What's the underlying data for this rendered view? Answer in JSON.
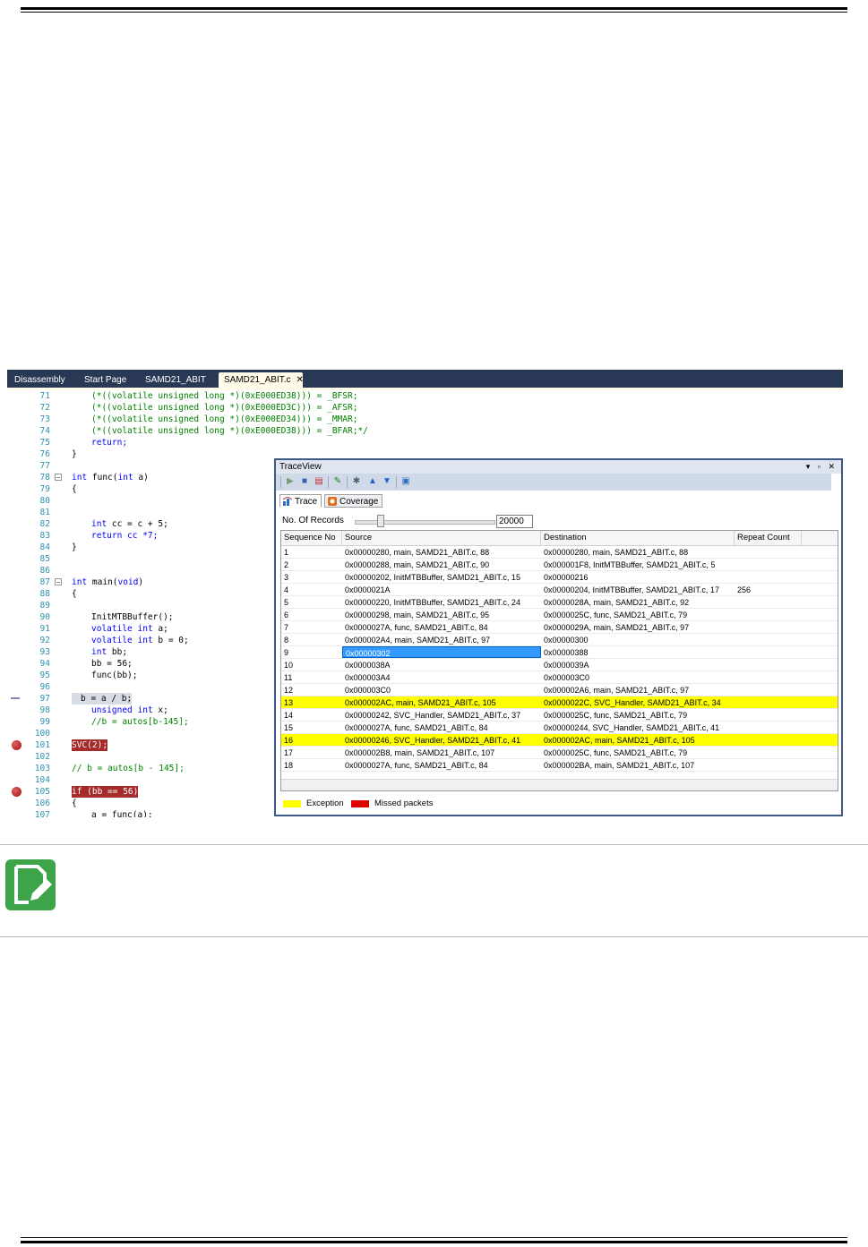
{
  "editor": {
    "tabs": [
      {
        "label": "Disassembly"
      },
      {
        "label": "Start Page"
      },
      {
        "label": "SAMD21_ABIT"
      },
      {
        "label": "SAMD21_ABIT.c"
      }
    ],
    "close_glyph": "✕",
    "lines": [
      {
        "n": "71",
        "text": "(*((volatile unsigned long *)(0xE000ED38))) = _BFSR;",
        "style": "cm"
      },
      {
        "n": "72",
        "text": "(*((volatile unsigned long *)(0xE000ED3C))) = _AFSR;",
        "style": "cm"
      },
      {
        "n": "73",
        "text": "(*((volatile unsigned long *)(0xE000ED34))) = _MMAR;",
        "style": "cm"
      },
      {
        "n": "74",
        "text": "(*((volatile unsigned long *)(0xE000ED38))) = _BFAR;*/",
        "style": "cm"
      },
      {
        "n": "75",
        "text": "return;",
        "style": "kw"
      },
      {
        "n": "76",
        "text": "}",
        "style": ""
      },
      {
        "n": "77",
        "text": "",
        "style": ""
      },
      {
        "n": "78",
        "text": "int func(int a)",
        "style": "fn"
      },
      {
        "n": "79",
        "text": "{",
        "style": ""
      },
      {
        "n": "80",
        "text": "",
        "style": ""
      },
      {
        "n": "81",
        "text": "",
        "style": ""
      },
      {
        "n": "82",
        "text": "int cc = c + 5;",
        "style": "decl"
      },
      {
        "n": "83",
        "text": "return cc *7;",
        "style": "ret"
      },
      {
        "n": "84",
        "text": "}",
        "style": ""
      },
      {
        "n": "85",
        "text": "",
        "style": ""
      },
      {
        "n": "86",
        "text": "",
        "style": ""
      },
      {
        "n": "87",
        "text": "int main(void)",
        "style": "fn"
      },
      {
        "n": "88",
        "text": "{",
        "style": ""
      },
      {
        "n": "89",
        "text": "",
        "style": ""
      },
      {
        "n": "90",
        "text": "InitMTBBuffer();",
        "style": ""
      },
      {
        "n": "91",
        "text": "volatile int a;",
        "style": "vol"
      },
      {
        "n": "92",
        "text": "volatile int b = 0;",
        "style": "vol"
      },
      {
        "n": "93",
        "text": "int bb;",
        "style": "decl"
      },
      {
        "n": "94",
        "text": "bb = 56;",
        "style": ""
      },
      {
        "n": "95",
        "text": "func(bb);",
        "style": ""
      },
      {
        "n": "96",
        "text": "",
        "style": ""
      },
      {
        "n": "97",
        "text": "b = a / b;",
        "style": "grey"
      },
      {
        "n": "98",
        "text": "unsigned int x;",
        "style": "uns"
      },
      {
        "n": "99",
        "text": "//b = autos[b-145];",
        "style": "cm"
      },
      {
        "n": "100",
        "text": "",
        "style": ""
      },
      {
        "n": "101",
        "text": "SVC(2);",
        "style": "bp"
      },
      {
        "n": "102",
        "text": "",
        "style": ""
      },
      {
        "n": "103",
        "text": "// b = autos[b - 145];",
        "style": "cm"
      },
      {
        "n": "104",
        "text": "",
        "style": ""
      },
      {
        "n": "105",
        "text": "if (bb == 56)",
        "style": "bp"
      },
      {
        "n": "106",
        "text": "{",
        "style": ""
      },
      {
        "n": "107",
        "text": "a = func(a);",
        "style": ""
      }
    ]
  },
  "traceview": {
    "title": "TraceView",
    "window_controls": "▾ ▫ ✕",
    "tabs": [
      {
        "label": "Trace"
      },
      {
        "label": "Coverage"
      }
    ],
    "records_label": "No. Of Records",
    "records_value": "20000",
    "columns": [
      "Sequence No",
      "Source",
      "Destination",
      "Repeat Count"
    ],
    "rows": [
      {
        "seq": "1",
        "src": "0x00000280, main, SAMD21_ABIT.c, 88",
        "dst": "0x00000280, main, SAMD21_ABIT.c, 88",
        "rep": "",
        "exc": false
      },
      {
        "seq": "2",
        "src": "0x00000288, main, SAMD21_ABIT.c, 90",
        "dst": "0x000001F8, InitMTBBuffer, SAMD21_ABIT.c, 5",
        "rep": "",
        "exc": false
      },
      {
        "seq": "3",
        "src": "0x00000202, InitMTBBuffer, SAMD21_ABIT.c, 15",
        "dst": "0x00000216",
        "rep": "",
        "exc": false
      },
      {
        "seq": "4",
        "src": "0x0000021A",
        "dst": "0x00000204, InitMTBBuffer, SAMD21_ABIT.c, 17",
        "rep": "256",
        "exc": false
      },
      {
        "seq": "5",
        "src": "0x00000220, InitMTBBuffer, SAMD21_ABIT.c, 24",
        "dst": "0x0000028A, main, SAMD21_ABIT.c, 92",
        "rep": "",
        "exc": false
      },
      {
        "seq": "6",
        "src": "0x00000298, main, SAMD21_ABIT.c, 95",
        "dst": "0x0000025C, func, SAMD21_ABIT.c, 79",
        "rep": "",
        "exc": false
      },
      {
        "seq": "7",
        "src": "0x0000027A, func, SAMD21_ABIT.c, 84",
        "dst": "0x0000029A, main, SAMD21_ABIT.c, 97",
        "rep": "",
        "exc": false
      },
      {
        "seq": "8",
        "src": "0x000002A4, main, SAMD21_ABIT.c, 97",
        "dst": "0x00000300",
        "rep": "",
        "exc": false
      },
      {
        "seq": "9",
        "src": "0x00000302",
        "dst": "0x00000388",
        "rep": "",
        "exc": false,
        "sel": true
      },
      {
        "seq": "10",
        "src": "0x0000038A",
        "dst": "0x0000039A",
        "rep": "",
        "exc": false
      },
      {
        "seq": "11",
        "src": "0x000003A4",
        "dst": "0x000003C0",
        "rep": "",
        "exc": false
      },
      {
        "seq": "12",
        "src": "0x000003C0",
        "dst": "0x000002A6, main, SAMD21_ABIT.c, 97",
        "rep": "",
        "exc": false
      },
      {
        "seq": "13",
        "src": "0x000002AC, main, SAMD21_ABIT.c, 105",
        "dst": "0x0000022C, SVC_Handler, SAMD21_ABIT.c, 34",
        "rep": "",
        "exc": true
      },
      {
        "seq": "14",
        "src": "0x00000242, SVC_Handler, SAMD21_ABIT.c, 37",
        "dst": "0x0000025C, func, SAMD21_ABIT.c, 79",
        "rep": "",
        "exc": false
      },
      {
        "seq": "15",
        "src": "0x0000027A, func, SAMD21_ABIT.c, 84",
        "dst": "0x00000244, SVC_Handler, SAMD21_ABIT.c, 41",
        "rep": "",
        "exc": false
      },
      {
        "seq": "16",
        "src": "0x00000246, SVC_Handler, SAMD21_ABIT.c, 41",
        "dst": "0x000002AC, main, SAMD21_ABIT.c, 105",
        "rep": "",
        "exc": true
      },
      {
        "seq": "17",
        "src": "0x000002B8, main, SAMD21_ABIT.c, 107",
        "dst": "0x0000025C, func, SAMD21_ABIT.c, 79",
        "rep": "",
        "exc": false
      },
      {
        "seq": "18",
        "src": "0x0000027A, func, SAMD21_ABIT.c, 84",
        "dst": "0x000002BA, main, SAMD21_ABIT.c, 107",
        "rep": "",
        "exc": false
      }
    ],
    "legend": [
      {
        "label": "Exception",
        "color": "#ffff00"
      },
      {
        "label": "Missed packets",
        "color": "#e00000"
      }
    ]
  },
  "note": {
    "icon": "note-pencil-icon"
  }
}
